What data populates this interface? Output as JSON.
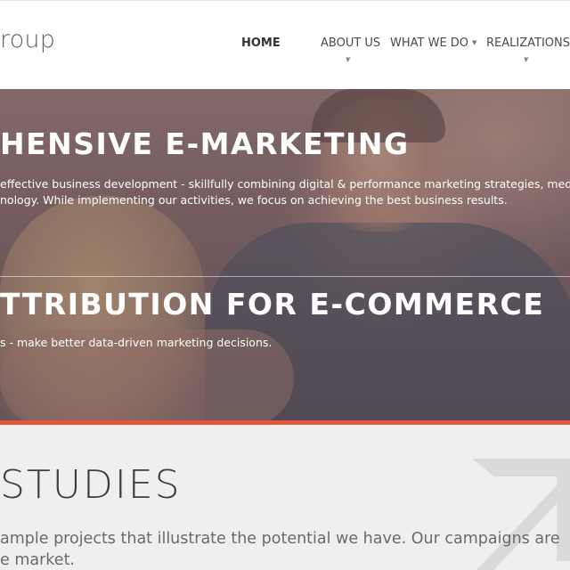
{
  "header": {
    "logo_text": "roup",
    "nav": [
      {
        "label": "HOME",
        "active": true,
        "has_dropdown": false
      },
      {
        "label": "ABOUT US",
        "active": false,
        "has_dropdown": true
      },
      {
        "label": "WHAT WE DO",
        "active": false,
        "has_dropdown": true
      },
      {
        "label": "REALIZATIONS",
        "active": false,
        "has_dropdown": true
      }
    ]
  },
  "hero": {
    "slide1": {
      "title": "HENSIVE E-MARKETING",
      "text_line1": "effective business development - skillfully combining digital & performance marketing strategies, media",
      "text_line2": "nology. While implementing our activities, we focus on achieving the best business results."
    },
    "slide2": {
      "title": "TTRIBUTION FOR E-COMMERCE",
      "text_line1": "s - make better data-driven marketing decisions."
    }
  },
  "colors": {
    "accent": "#e5553a",
    "section_bg": "#efefef"
  },
  "case_studies": {
    "title": "STUDIES",
    "text_line1": "ample projects that illustrate the potential we have. Our campaigns are",
    "text_line2": "e market.",
    "decor_icon": "arrow-up-right-icon"
  }
}
